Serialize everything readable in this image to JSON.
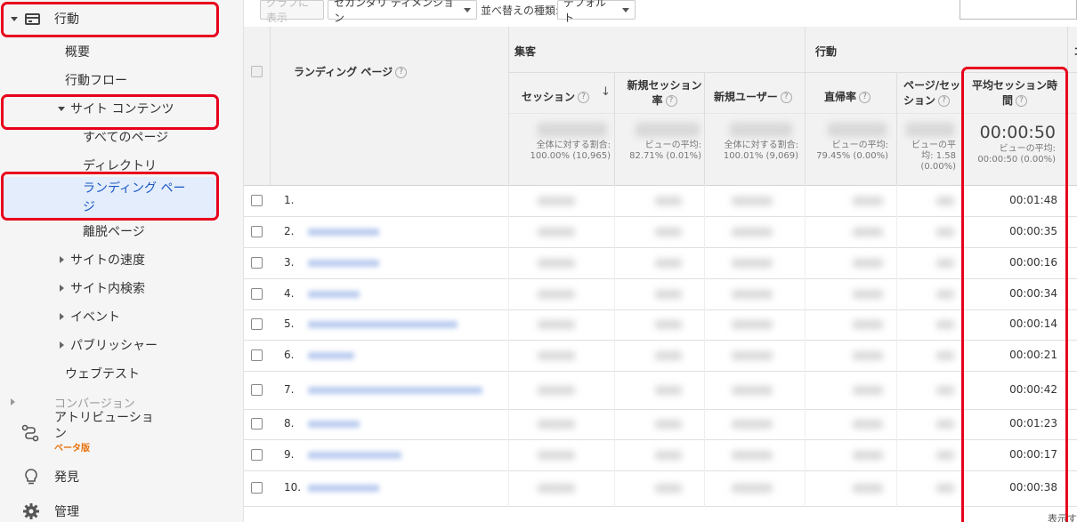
{
  "sidebar": {
    "behavior": "行動",
    "overview": "概要",
    "flow": "行動フロー",
    "site_content": "サイト コンテンツ",
    "all_pages": "すべてのページ",
    "directory": "ディレクトリ",
    "landing_pages_1": "ランディング ペー",
    "landing_pages_2": "ジ",
    "exit_pages": "離脱ページ",
    "site_speed": "サイトの速度",
    "site_search": "サイト内検索",
    "events": "イベント",
    "publisher": "パブリッシャー",
    "experiments": "ウェブテスト",
    "conversions_partial": "コンバージョン",
    "attribution_1": "アトリビューショ",
    "attribution_2": "ン",
    "beta": "ベータ版",
    "discover": "発見",
    "admin": "管理"
  },
  "toolbar": {
    "chart_btn": "グラフに表示",
    "secondary_dimension": "セカンダリ ディメンション",
    "sort_type_label": "並べ替えの種類:",
    "sort_default": "デフォルト"
  },
  "table": {
    "dimension_header": "ランディング ページ",
    "group_acquisition": "集客",
    "group_behavior": "行動",
    "group_next": "コ",
    "col_sessions": "セッション",
    "col_new_sessions_1": "新規セッション",
    "col_new_sessions_2": "率",
    "col_new_users": "新規ユーザー",
    "col_bounce": "直帰率",
    "col_pages_1": "ページ/セッ",
    "col_pages_2": "ション",
    "col_avg_dur_1": "平均セッション時",
    "col_avg_dur_2": "間",
    "totals": {
      "sessions_1": "全体に対する割合:",
      "sessions_2": "100.00% (10,965)",
      "new_sessions_1": "ビューの平均:",
      "new_sessions_2": "82.71% (0.01%)",
      "new_users_1": "全体に対する割合:",
      "new_users_2": "100.01% (9,069)",
      "bounce_1": "ビューの平均:",
      "bounce_2": "79.45% (0.00%)",
      "pages_1": "ビューの平",
      "pages_2": "均: 1.58",
      "pages_3": "(0.00%)",
      "avg_dur_big": "00:00:50",
      "avg_dur_1": "ビューの平均:",
      "avg_dur_2": "00:00:50 (0.00%)"
    },
    "rows": [
      {
        "num": "1.",
        "avg_dur": "00:01:48"
      },
      {
        "num": "2.",
        "avg_dur": "00:00:35"
      },
      {
        "num": "3.",
        "avg_dur": "00:00:16"
      },
      {
        "num": "4.",
        "avg_dur": "00:00:34"
      },
      {
        "num": "5.",
        "avg_dur": "00:00:14"
      },
      {
        "num": "6.",
        "avg_dur": "00:00:21"
      },
      {
        "num": "7.",
        "avg_dur": "00:00:42"
      },
      {
        "num": "8.",
        "avg_dur": "00:01:23"
      },
      {
        "num": "9.",
        "avg_dur": "00:00:17"
      },
      {
        "num": "10.",
        "avg_dur": "00:00:38"
      }
    ],
    "footer": "表示す"
  },
  "colors": {
    "highlight": "#e8001c",
    "selected_bg": "#e3edfb",
    "beta": "#e8710a"
  }
}
